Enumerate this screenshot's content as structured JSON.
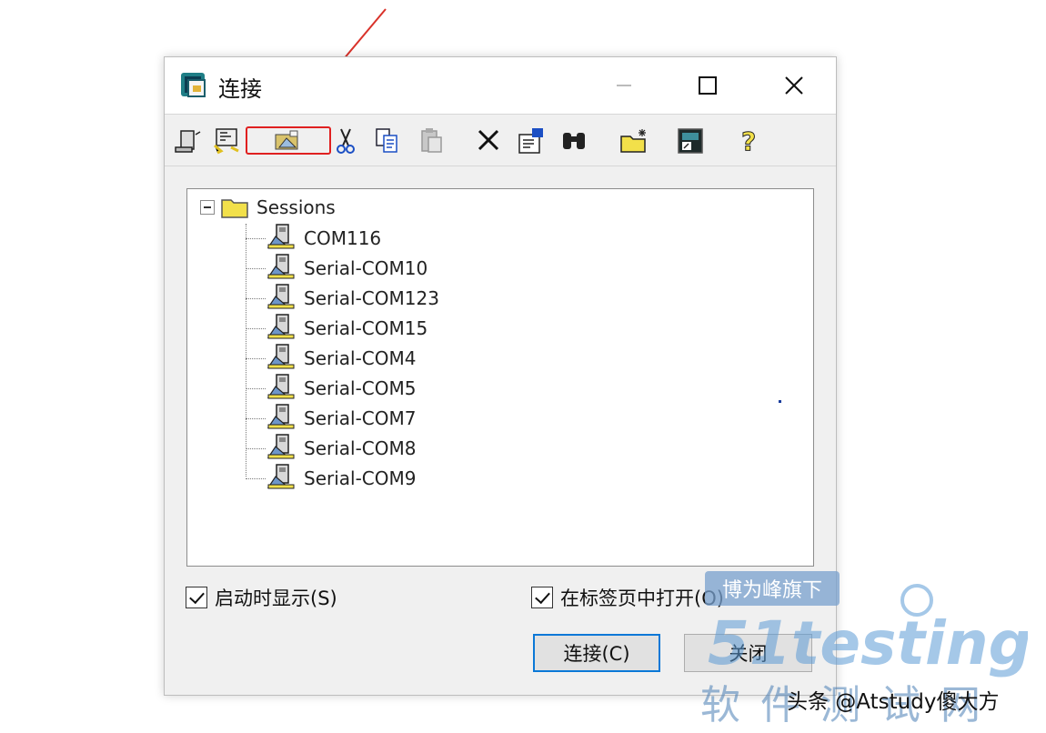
{
  "window": {
    "title": "连接",
    "controls": {
      "minimize": "—",
      "maximize": "☐",
      "close": "✕"
    }
  },
  "toolbar": {
    "icons": [
      "quick-connect-icon",
      "connect-in-tab-icon",
      "new-session-icon",
      "cut-icon",
      "copy-icon",
      "paste-icon",
      "delete-icon",
      "properties-icon",
      "find-icon",
      "new-folder-icon",
      "create-shortcut-icon",
      "help-icon"
    ]
  },
  "tree": {
    "root": "Sessions",
    "sessions": [
      "COM116",
      "Serial-COM10",
      "Serial-COM123",
      "Serial-COM15",
      "Serial-COM4",
      "Serial-COM5",
      "Serial-COM7",
      "Serial-COM8",
      "Serial-COM9"
    ]
  },
  "options": {
    "show_on_startup": {
      "label": "启动时显示(S)",
      "checked": true
    },
    "open_in_tab": {
      "label": "在标签页中打开(O)",
      "checked": true
    }
  },
  "buttons": {
    "connect": "连接(C)",
    "close": "关闭"
  },
  "overlay": {
    "badge": "博为峰旗下",
    "logo_text": "51testing",
    "logo_sub": "软件测试网",
    "credit": "头条 @Atstudy傻大方"
  },
  "colors": {
    "highlight": "#e02020",
    "accent": "#0a78d7",
    "arrow": "#d9322a"
  }
}
